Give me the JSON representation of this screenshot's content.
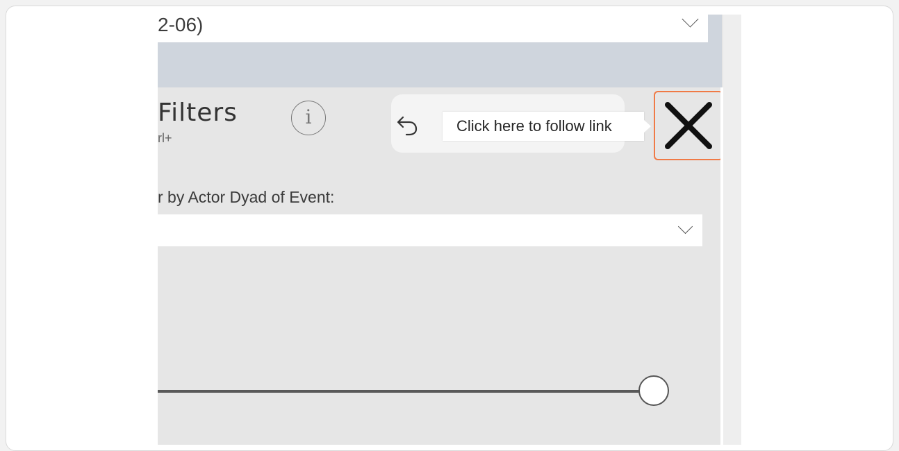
{
  "date_filter": {
    "text": "2-06)"
  },
  "panel": {
    "title": "Filters",
    "subtitle": "rl+",
    "info_glyph": "i"
  },
  "tooltip": {
    "text": "Click here to follow link"
  },
  "actor_filter": {
    "label": "r by Actor Dyad of Event:",
    "selected_value": ""
  },
  "slider": {
    "value_fraction": 1.0
  },
  "icons": {
    "back": "back-arrow-icon",
    "close": "close-icon",
    "info": "info-icon",
    "dropdown": "chevron-down-icon"
  },
  "colors": {
    "highlight": "#f07a46",
    "top_band": "#cfd5dd",
    "panel_bg": "#e6e6e6"
  }
}
